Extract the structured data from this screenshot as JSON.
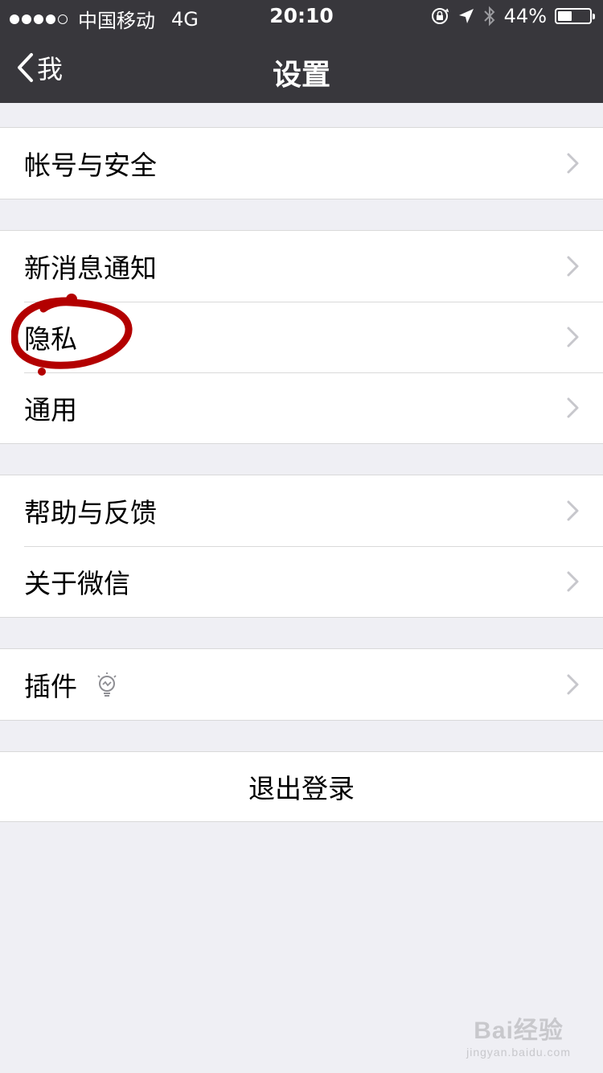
{
  "status_bar": {
    "carrier": "中国移动",
    "network": "4G",
    "time": "20:10",
    "battery_percent_label": "44%",
    "battery_level": 0.44,
    "icons": [
      "orientation-lock-icon",
      "location-arrow-icon",
      "bluetooth-icon",
      "battery-icon"
    ]
  },
  "nav": {
    "back_label": "我",
    "title": "设置"
  },
  "groups": [
    {
      "items": [
        {
          "label": "帐号与安全"
        }
      ]
    },
    {
      "items": [
        {
          "label": "新消息通知"
        },
        {
          "label": "隐私"
        },
        {
          "label": "通用"
        }
      ]
    },
    {
      "items": [
        {
          "label": "帮助与反馈"
        },
        {
          "label": "关于微信"
        }
      ]
    },
    {
      "items": [
        {
          "label": "插件"
        }
      ]
    }
  ],
  "logout_label": "退出登录",
  "annotation_color": "#b30000",
  "watermark": {
    "main": "Bai经验",
    "sub": "jingyan.baidu.com"
  }
}
